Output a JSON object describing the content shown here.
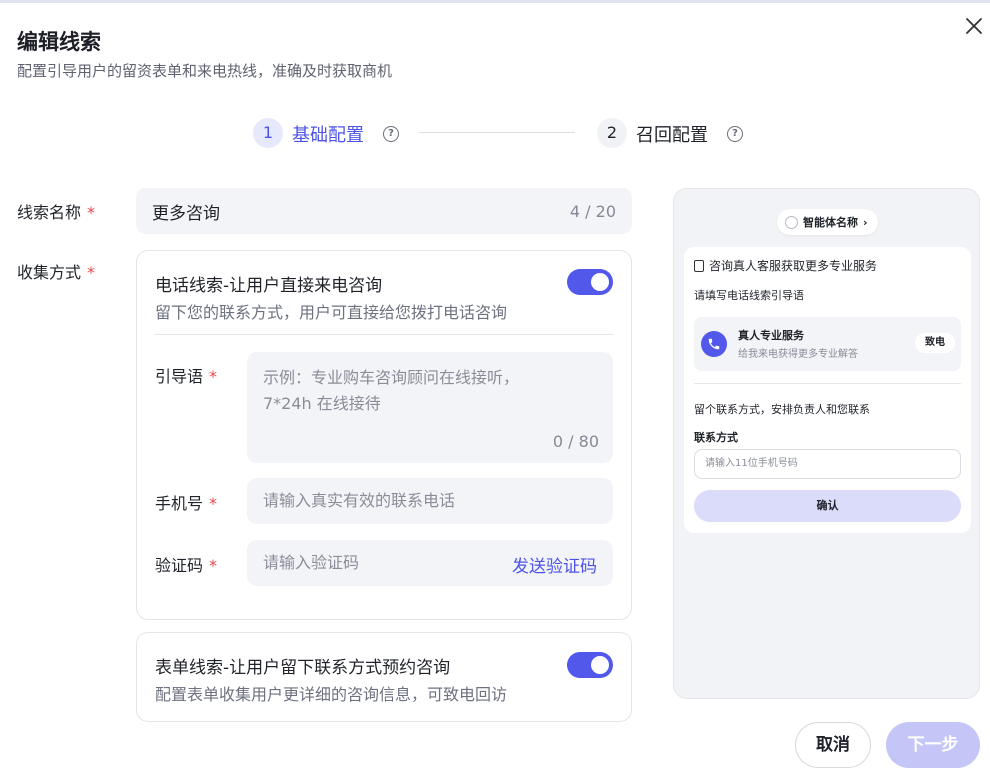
{
  "dialog": {
    "title": "编辑线索",
    "subtitle": "配置引导用户的留资表单和来电热线，准确及时获取商机"
  },
  "steps": [
    {
      "num": "1",
      "label": "基础配置",
      "active": true,
      "help_icon": "question-circle-icon"
    },
    {
      "num": "2",
      "label": "召回配置",
      "active": false,
      "help_icon": "question-circle-icon"
    }
  ],
  "form": {
    "name": {
      "label": "线索名称",
      "required_mark": "*",
      "value": "更多咨询",
      "counter": "4 / 20"
    },
    "collect": {
      "label": "收集方式",
      "required_mark": "*"
    }
  },
  "phone_lead": {
    "title": "电话线索-让用户直接来电咨询",
    "desc": "留下您的联系方式，用户可直接给您拨打电话咨询",
    "enabled": true,
    "guide": {
      "label": "引导语",
      "required_mark": "*",
      "placeholder_line1": "示例：专业购车咨询顾问在线接听，",
      "placeholder_line2": "7*24h 在线接待",
      "counter": "0 / 80"
    },
    "phone": {
      "label": "手机号",
      "required_mark": "*",
      "placeholder": "请输入真实有效的联系电话"
    },
    "code": {
      "label": "验证码",
      "required_mark": "*",
      "placeholder": "请输入验证码",
      "send_label": "发送验证码"
    }
  },
  "form_lead": {
    "title": "表单线索-让用户留下联系方式预约咨询",
    "desc": "配置表单收集用户更详细的咨询信息，可致电回访",
    "enabled": true
  },
  "preview": {
    "agent_name": "智能体名称",
    "agent_chevron": "›",
    "card_title": "咨询真人客服获取更多专业服务",
    "guide_text": "请填写电话线索引导语",
    "service_title": "真人专业服务",
    "service_sub": "给我来电获得更多专业解答",
    "call_label": "致电",
    "contact_intro": "留个联系方式，安排负责人和您联系",
    "contact_label": "联系方式",
    "input_placeholder": "请输入11位手机号码",
    "confirm_label": "确认"
  },
  "footer": {
    "cancel_label": "取消",
    "next_label": "下一步"
  },
  "colors": {
    "accent": "#4d53e8",
    "toggle_on": "#5158ea",
    "required": "#e5484d",
    "next_disabled": "#c3c6f7"
  }
}
